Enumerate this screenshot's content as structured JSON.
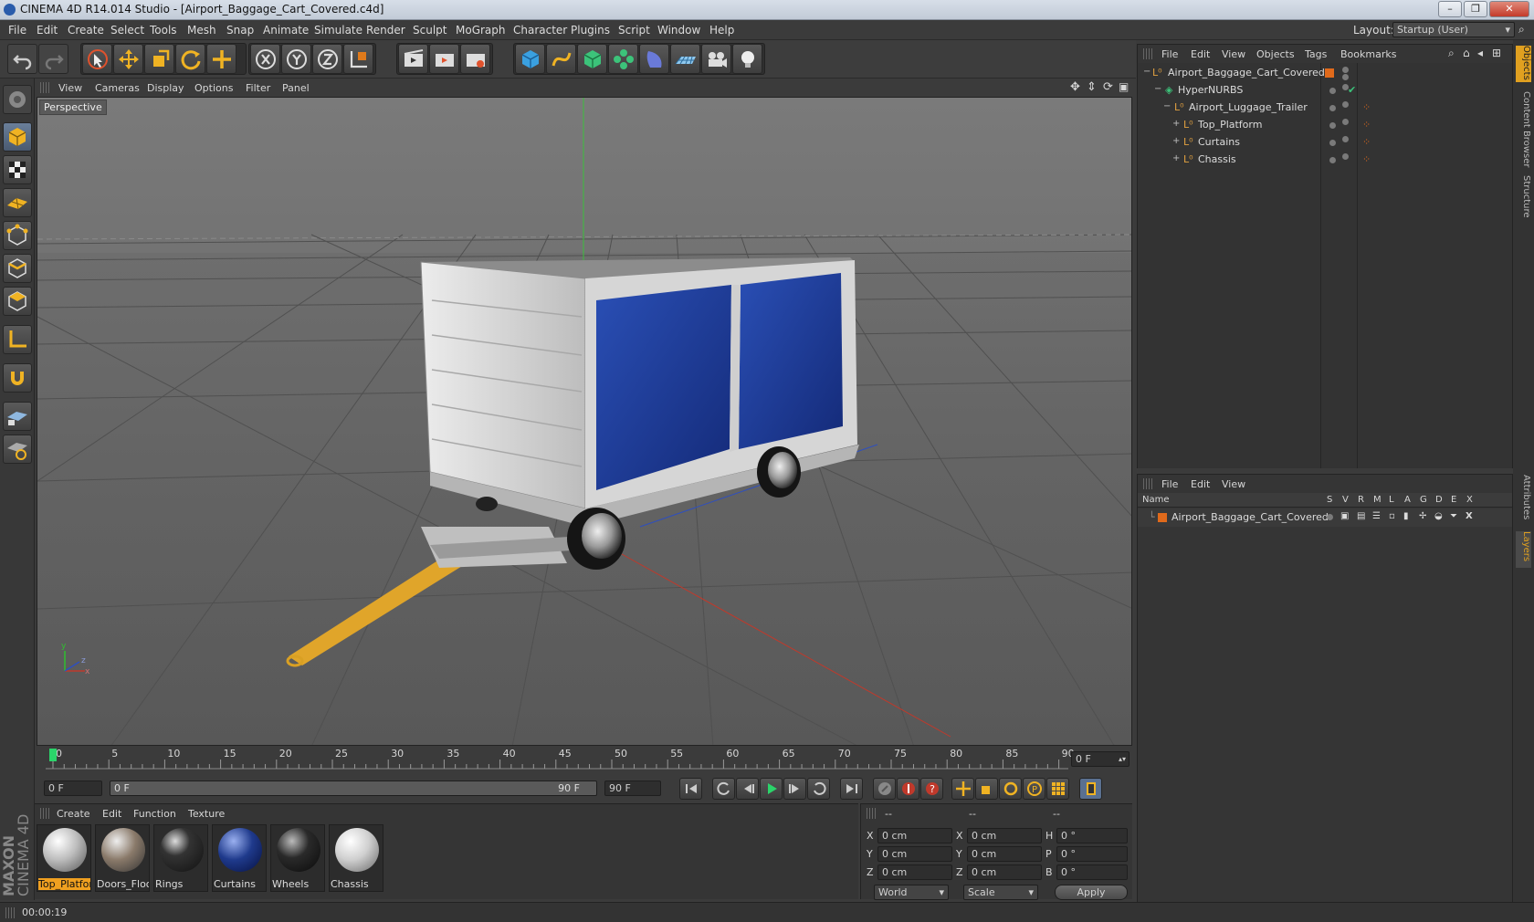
{
  "window": {
    "title": "CINEMA 4D R14.014 Studio - [Airport_Baggage_Cart_Covered.c4d]"
  },
  "menubar": [
    "File",
    "Edit",
    "Create",
    "Select",
    "Tools",
    "Mesh",
    "Snap",
    "Animate",
    "Simulate",
    "Render",
    "Sculpt",
    "MoGraph",
    "Character",
    "Plugins",
    "Script",
    "Window",
    "Help"
  ],
  "layout": {
    "label": "Layout:",
    "value": "Startup (User)"
  },
  "viewport": {
    "menu": [
      "View",
      "Cameras",
      "Display",
      "Options",
      "Filter",
      "Panel"
    ],
    "camera_label": "Perspective",
    "axis": {
      "y": "y",
      "z": "z",
      "x": "x"
    }
  },
  "timeline": {
    "ticks": [
      "0",
      "5",
      "10",
      "15",
      "20",
      "25",
      "30",
      "35",
      "40",
      "45",
      "50",
      "55",
      "60",
      "65",
      "70",
      "75",
      "80",
      "85",
      "90"
    ],
    "current_frame": "0 F"
  },
  "transport": {
    "start_field": "0 F",
    "range_start": "0 F",
    "range_end": "90 F",
    "end_field": "90 F"
  },
  "materials": {
    "menu": [
      "Create",
      "Edit",
      "Function",
      "Texture"
    ],
    "items": [
      {
        "label": "Top_Platfor",
        "selected": true,
        "color": "#d8d8d8"
      },
      {
        "label": "Doors_Floo",
        "selected": false,
        "color": "#8a7a6a"
      },
      {
        "label": "Rings",
        "selected": false,
        "color": "#222222"
      },
      {
        "label": "Curtains",
        "selected": false,
        "color": "#1f3a8c"
      },
      {
        "label": "Wheels",
        "selected": false,
        "color": "#2a2a2a"
      },
      {
        "label": "Chassis",
        "selected": false,
        "color": "#cfcfcf"
      }
    ]
  },
  "coordinates": {
    "headers": [
      "--",
      "--",
      "--"
    ],
    "rows": [
      {
        "a": "X",
        "av": "0 cm",
        "b": "X",
        "bv": "0 cm",
        "c": "H",
        "cv": "0 °"
      },
      {
        "a": "Y",
        "av": "0 cm",
        "b": "Y",
        "bv": "0 cm",
        "c": "P",
        "cv": "0 °"
      },
      {
        "a": "Z",
        "av": "0 cm",
        "b": "Z",
        "bv": "0 cm",
        "c": "B",
        "cv": "0 °"
      }
    ],
    "mode": "World",
    "scale": "Scale",
    "apply": "Apply"
  },
  "object_manager": {
    "menu": [
      "File",
      "Edit",
      "View",
      "Objects",
      "Tags",
      "Bookmarks"
    ],
    "objects": [
      {
        "name": "Airport_Baggage_Cart_Covered",
        "indent": 0,
        "expand": "−"
      },
      {
        "name": "HyperNURBS",
        "indent": 1,
        "expand": "−"
      },
      {
        "name": "Airport_Luggage_Trailer",
        "indent": 2,
        "expand": "−"
      },
      {
        "name": "Top_Platform",
        "indent": 3,
        "expand": "+"
      },
      {
        "name": "Curtains",
        "indent": 3,
        "expand": "+"
      },
      {
        "name": "Chassis",
        "indent": 3,
        "expand": "+"
      }
    ]
  },
  "layer_manager": {
    "menu": [
      "File",
      "Edit",
      "View"
    ],
    "columns": [
      "Name",
      "S",
      "V",
      "R",
      "M",
      "L",
      "A",
      "G",
      "D",
      "E",
      "X"
    ],
    "layers": [
      {
        "name": "Airport_Baggage_Cart_Covered",
        "color": "#e06a1b"
      }
    ]
  },
  "right_tabs": [
    "Objects",
    "Content Browser",
    "Structure",
    "Attributes",
    "Layers"
  ],
  "status": {
    "time": "00:00:19"
  },
  "brand": {
    "line1": "MAXON",
    "line2": "CINEMA 4D"
  },
  "colors": {
    "accent": "#e06a1b",
    "timeline_marker": "#2bd46a",
    "curtain": "#1f3a8c"
  }
}
